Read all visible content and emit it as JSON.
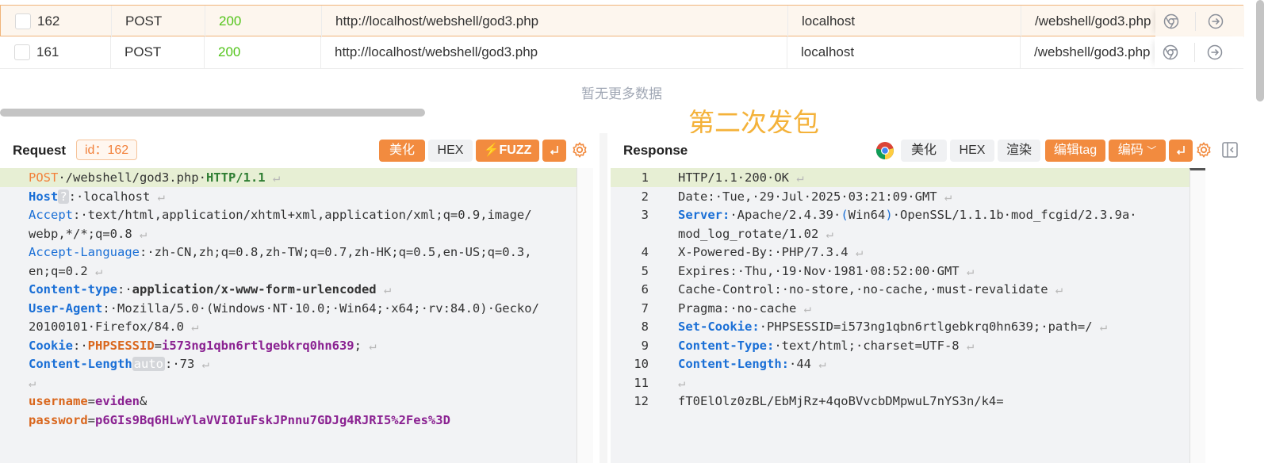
{
  "history_table": {
    "rows": [
      {
        "id": "162",
        "method": "POST",
        "status": "200",
        "url": "http://localhost/webshell/god3.php",
        "host": "localhost",
        "path": "/webshell/god3.php",
        "selected": true
      },
      {
        "id": "161",
        "method": "POST",
        "status": "200",
        "url": "http://localhost/webshell/god3.php",
        "host": "localhost",
        "path": "/webshell/god3.php",
        "selected": false
      }
    ],
    "empty_text": "暂无更多数据",
    "action_icons": [
      "chrome-icon",
      "arrow-right-circle-icon"
    ]
  },
  "annotation_text": "第二次发包",
  "request_panel": {
    "title": "Request",
    "id_badge": "id：162",
    "buttons": {
      "beautify": "美化",
      "hex": "HEX",
      "fuzz": "FUZZ",
      "wrap_icon": "wrap-icon",
      "settings_icon": "gear-icon"
    },
    "lines": [
      {
        "parts": [
          {
            "t": "POST",
            "c": "kw-m"
          },
          {
            "t": "·/webshell/god3.php·",
            "c": ""
          },
          {
            "t": "HTTP/1.1",
            "c": "kw-g"
          },
          {
            "t": " ↵",
            "c": "sp"
          }
        ],
        "highlight": true
      },
      {
        "parts": [
          {
            "t": "Host",
            "c": "kw-bb"
          },
          {
            "t": "?",
            "c": "tag"
          },
          {
            "t": ":·localhost",
            "c": ""
          },
          {
            "t": " ↵",
            "c": "sp"
          }
        ]
      },
      {
        "parts": [
          {
            "t": "Accept",
            "c": "kw-b"
          },
          {
            "t": ":·text/html,application/xhtml+xml,application/xml;q=0.9,image/",
            "c": ""
          }
        ]
      },
      {
        "parts": [
          {
            "t": "webp,*/*;q=0.8",
            "c": ""
          },
          {
            "t": " ↵",
            "c": "sp"
          }
        ]
      },
      {
        "parts": [
          {
            "t": "Accept-Language",
            "c": "kw-b"
          },
          {
            "t": ":·zh-CN,zh;q=0.8,zh-TW;q=0.7,zh-HK;q=0.5,en-US;q=0.3,",
            "c": ""
          }
        ]
      },
      {
        "parts": [
          {
            "t": "en;q=0.2",
            "c": ""
          },
          {
            "t": " ↵",
            "c": "sp"
          }
        ]
      },
      {
        "parts": [
          {
            "t": "Content-type",
            "c": "kw-bb"
          },
          {
            "t": ":·",
            "c": ""
          },
          {
            "t": "application/x-www-form-urlencoded",
            "c": "kw-bb2"
          },
          {
            "t": " ↵",
            "c": "sp"
          }
        ]
      },
      {
        "parts": [
          {
            "t": "User-Agent",
            "c": "kw-bb"
          },
          {
            "t": ":·Mozilla/5.0·(Windows·NT·10.0;·Win64;·x64;·rv:84.0)·Gecko/",
            "c": ""
          }
        ]
      },
      {
        "parts": [
          {
            "t": "20100101·Firefox/84.0",
            "c": ""
          },
          {
            "t": " ↵",
            "c": "sp"
          }
        ]
      },
      {
        "parts": [
          {
            "t": "Cookie",
            "c": "kw-bb"
          },
          {
            "t": ":·",
            "c": ""
          },
          {
            "t": "PHPSESSID",
            "c": "kw-o"
          },
          {
            "t": "=",
            "c": ""
          },
          {
            "t": "i573ng1qbn6rtlgebkrq0hn639",
            "c": "kw-p"
          },
          {
            "t": ";",
            "c": ""
          },
          {
            "t": " ↵",
            "c": "sp"
          }
        ]
      },
      {
        "parts": [
          {
            "t": "Content-Length",
            "c": "kw-bb"
          },
          {
            "t": "auto",
            "c": "tag"
          },
          {
            "t": ":·73",
            "c": ""
          },
          {
            "t": " ↵",
            "c": "sp"
          }
        ]
      },
      {
        "parts": [
          {
            "t": "↵",
            "c": "sp"
          }
        ]
      },
      {
        "parts": [
          {
            "t": "username",
            "c": "kw-o"
          },
          {
            "t": "=",
            "c": ""
          },
          {
            "t": "eviden",
            "c": "kw-p"
          },
          {
            "t": "&",
            "c": ""
          }
        ]
      },
      {
        "parts": [
          {
            "t": "password",
            "c": "kw-o"
          },
          {
            "t": "=",
            "c": ""
          },
          {
            "t": "p6GIs9Bq6HLwYlaVVI0IuFskJPnnu7GDJg4RJRI5%2Fes%3D",
            "c": "kw-p"
          }
        ]
      }
    ]
  },
  "response_panel": {
    "title": "Response",
    "buttons": {
      "chrome_icon": "chrome-icon",
      "beautify": "美化",
      "hex": "HEX",
      "render": "渲染",
      "edit_tag": "编辑tag",
      "encode": "编码",
      "wrap_icon": "wrap-icon",
      "settings_icon": "gear-icon"
    },
    "lines": [
      {
        "n": "1",
        "parts": [
          {
            "t": "HTTP/1.1·200·OK",
            "c": ""
          },
          {
            "t": " ↵",
            "c": "sp"
          }
        ],
        "highlight": true
      },
      {
        "n": "2",
        "parts": [
          {
            "t": "Date:·Tue,·29·Jul·2025·03:21:09·GMT",
            "c": ""
          },
          {
            "t": " ↵",
            "c": "sp"
          }
        ]
      },
      {
        "n": "3",
        "parts": [
          {
            "t": "Server:",
            "c": "kw-bb"
          },
          {
            "t": "·Apache/2.4.39·",
            "c": ""
          },
          {
            "t": "(",
            "c": "kw-b"
          },
          {
            "t": "Win64",
            "c": ""
          },
          {
            "t": ")",
            "c": "kw-b"
          },
          {
            "t": "·OpenSSL/1.1.1b·mod_fcgid/2.3.9a·",
            "c": ""
          }
        ]
      },
      {
        "n": "",
        "parts": [
          {
            "t": "mod_log_rotate/1.02",
            "c": ""
          },
          {
            "t": " ↵",
            "c": "sp"
          }
        ]
      },
      {
        "n": "4",
        "parts": [
          {
            "t": "X-Powered-By:·PHP/7.3.4",
            "c": ""
          },
          {
            "t": " ↵",
            "c": "sp"
          }
        ]
      },
      {
        "n": "5",
        "parts": [
          {
            "t": "Expires:·Thu,·19·Nov·1981·08:52:00·GMT",
            "c": ""
          },
          {
            "t": " ↵",
            "c": "sp"
          }
        ]
      },
      {
        "n": "6",
        "parts": [
          {
            "t": "Cache-Control:·no-store,·no-cache,·must-revalidate",
            "c": ""
          },
          {
            "t": " ↵",
            "c": "sp"
          }
        ]
      },
      {
        "n": "7",
        "parts": [
          {
            "t": "Pragma:·no-cache",
            "c": ""
          },
          {
            "t": " ↵",
            "c": "sp"
          }
        ]
      },
      {
        "n": "8",
        "parts": [
          {
            "t": "Set-Cookie:",
            "c": "kw-bb"
          },
          {
            "t": "·PHPSESSID=i573ng1qbn6rtlgebkrq0hn639;·path=/",
            "c": ""
          },
          {
            "t": " ↵",
            "c": "sp"
          }
        ]
      },
      {
        "n": "9",
        "parts": [
          {
            "t": "Content-Type:",
            "c": "kw-bb"
          },
          {
            "t": "·text/html;·charset=UTF-8",
            "c": ""
          },
          {
            "t": " ↵",
            "c": "sp"
          }
        ]
      },
      {
        "n": "10",
        "parts": [
          {
            "t": "Content-Length:",
            "c": "kw-bb"
          },
          {
            "t": "·44",
            "c": ""
          },
          {
            "t": " ↵",
            "c": "sp"
          }
        ]
      },
      {
        "n": "11",
        "parts": [
          {
            "t": "↵",
            "c": "sp"
          }
        ]
      },
      {
        "n": "12",
        "parts": [
          {
            "t": "fT0ElOlz0zBL/EbMjRz+4qoBVvcbDMpwuL7nYS3n/k4=",
            "c": ""
          }
        ]
      }
    ]
  },
  "sidebar_toggle_icon": "panel-collapse-icon",
  "colors": {
    "accent_orange": "#f28b3f",
    "status_green": "#52c41a",
    "annotation_yellow": "#f4b23a",
    "header_blue": "#1a6fd6"
  }
}
